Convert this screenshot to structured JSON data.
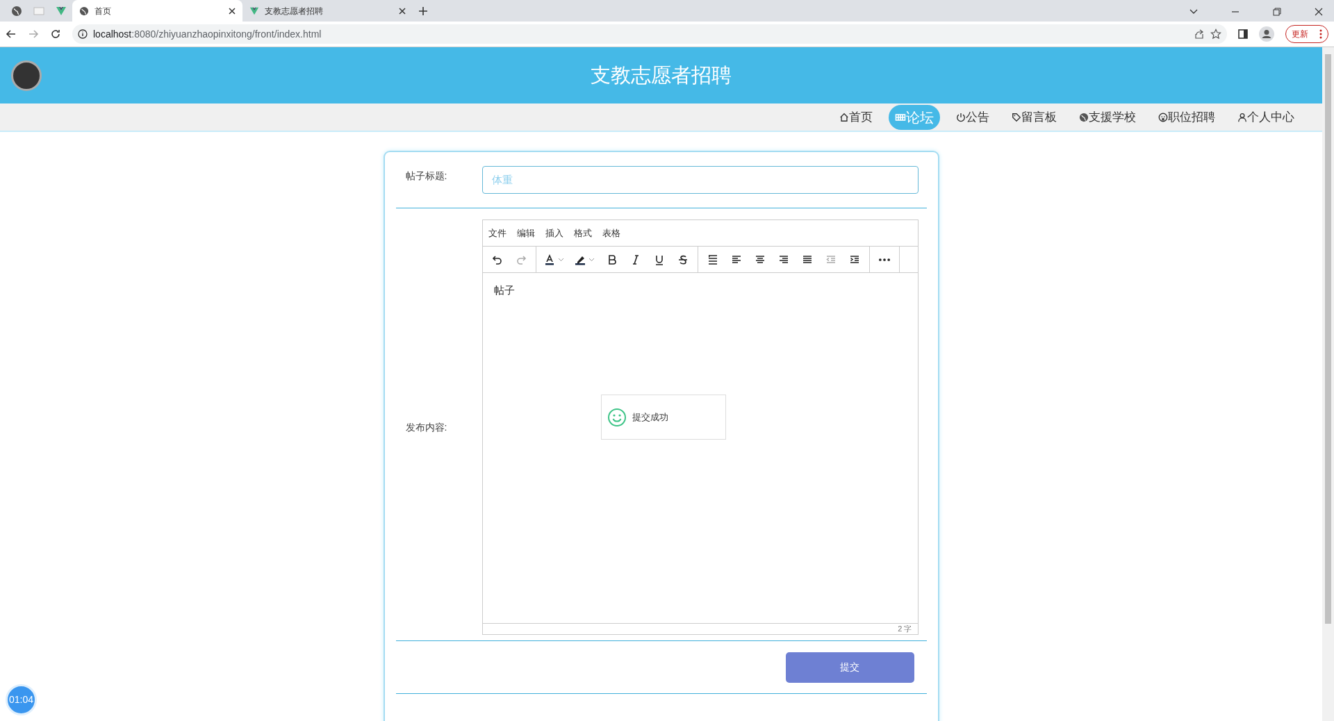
{
  "browser": {
    "pinned_tabs": [
      {
        "kind": "globe"
      },
      {
        "kind": "page"
      },
      {
        "kind": "vue"
      }
    ],
    "tabs": [
      {
        "label": "首页",
        "kind": "globe",
        "selected": true
      },
      {
        "label": "支教志愿者招聘",
        "kind": "vue",
        "selected": false
      }
    ],
    "url_host": "localhost",
    "url_rest": ":8080/zhiyuanzhaopinxitong/front/index.html",
    "update_label": "更新"
  },
  "header": {
    "title": "支教志愿者招聘"
  },
  "nav": [
    {
      "label": "首页",
      "kind": "home",
      "selected": false
    },
    {
      "label": "论坛",
      "kind": "forum",
      "selected": true
    },
    {
      "label": "公告",
      "kind": "power",
      "selected": false
    },
    {
      "label": "留言板",
      "kind": "tag",
      "selected": false
    },
    {
      "label": "支援学校",
      "kind": "globe",
      "selected": false
    },
    {
      "label": "职位招聘",
      "kind": "face",
      "selected": false
    },
    {
      "label": "个人中心",
      "kind": "user",
      "selected": false
    }
  ],
  "form": {
    "title_label": "帖子标题:",
    "title_value": "体重",
    "content_label": "发布内容:",
    "editor": {
      "menus": [
        "文件",
        "编辑",
        "插入",
        "格式",
        "表格"
      ],
      "toolbar": [
        [
          {
            "kind": "undo",
            "disabled": false
          },
          {
            "kind": "redo",
            "disabled": true
          }
        ],
        [
          {
            "kind": "text-color",
            "disabled": false
          },
          {
            "kind": "highlight",
            "disabled": false
          },
          {
            "kind": "bold",
            "disabled": false
          },
          {
            "kind": "italic",
            "disabled": false
          },
          {
            "kind": "underline",
            "disabled": false
          },
          {
            "kind": "strike",
            "disabled": false
          }
        ],
        [
          {
            "kind": "line-height",
            "disabled": false
          },
          {
            "kind": "align-left",
            "disabled": false
          },
          {
            "kind": "align-center",
            "disabled": false
          },
          {
            "kind": "align-right",
            "disabled": false
          },
          {
            "kind": "justify",
            "disabled": false
          },
          {
            "kind": "outdent",
            "disabled": true
          },
          {
            "kind": "indent",
            "disabled": false
          }
        ],
        [
          {
            "kind": "more",
            "disabled": false
          }
        ]
      ],
      "content": "帖子",
      "word_count": "2 字"
    },
    "toast": "提交成功",
    "submit": "提交"
  },
  "timer": "01:04"
}
